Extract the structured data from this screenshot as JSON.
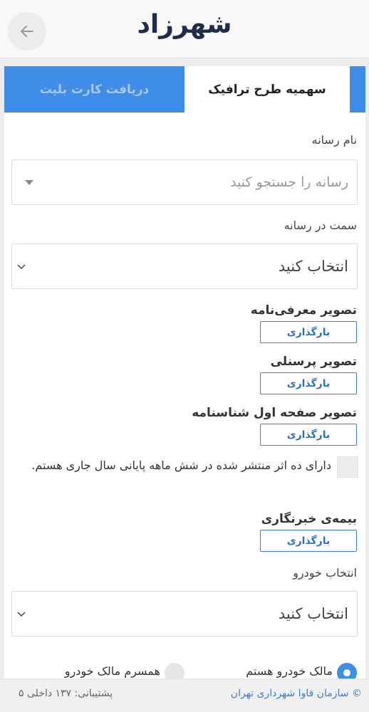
{
  "header": {
    "logo": "شهرزاد",
    "back_icon": "arrow-left-icon"
  },
  "tabs": {
    "active": "سهمیه طرح ترافیک",
    "inactive": "دریافت کارت بلیت"
  },
  "form": {
    "media_label": "نام رسانه",
    "media_placeholder": "رسانه را جستجو کنید",
    "position_label": "سمت در رسانه",
    "position_value": "انتخاب کنید",
    "intro_image_label": "تصویر معرفی‌نامه",
    "personnel_image_label": "تصویر پرسنلی",
    "id_page_label": "تصویر صفحه اول شناسنامه",
    "upload_label": "بارگذاری",
    "checkbox_text": "دارای ده اثر منتشر شده در شش ماهه پایانی سال جاری هستم.",
    "insurance_label": "بیمه‌ی خبرنگاری",
    "car_label": "انتخاب خودرو",
    "car_value": "انتخاب کنید",
    "radio_owner": "مالک خودرو هستم",
    "radio_spouse": "همسرم مالک خودرو"
  },
  "footer": {
    "org": "© سازمان فاوا شهرداری تهران",
    "support": "پشتیبانی: ۱۳۷ داخلی ۵"
  },
  "colors": {
    "accent": "#3d8de9",
    "logo": "#1f2d4c",
    "link": "#2c6fc7"
  }
}
